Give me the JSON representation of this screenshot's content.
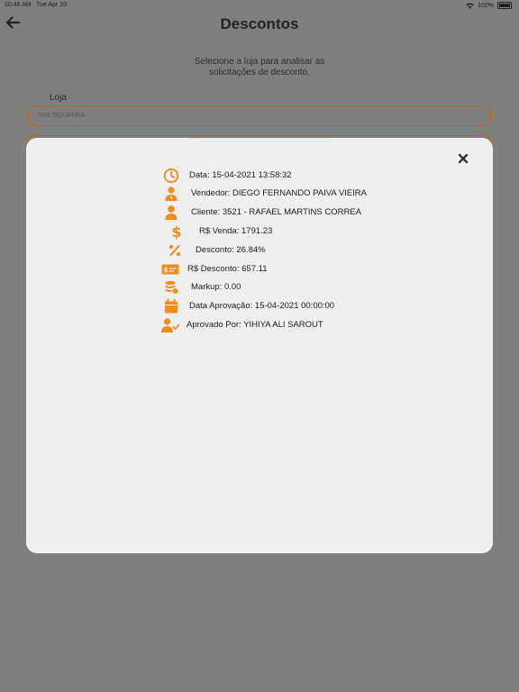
{
  "status": {
    "time": "10:46 AM",
    "date": "Tue Apr 20",
    "battery": "100%"
  },
  "header": {
    "title": "Descontos"
  },
  "page": {
    "subtitle_line1": "Selecione a loja para analisar as",
    "subtitle_line2": "solicitações de desconto.",
    "loja_label": "Loja",
    "loja_value": "YAS TIQUATIRA"
  },
  "detail": {
    "date": "Data: 15-04-2021 13:58:32",
    "seller": "Vendedor: DIEGO FERNANDO PAIVA VIEIRA",
    "client": "Cliente: 3521 - RAFAEL MARTINS CORREA",
    "sale": "R$ Venda: 1791.23",
    "discount": "Desconto: 26.84%",
    "discount_value": "R$ Desconto: 657.11",
    "markup": "Markup: 0.00",
    "approval_date": "Data Aprovação: 15-04-2021 00:00:00",
    "approved_by": "Aprovado Por: YIHIYA ALI SAROUT"
  },
  "colors": {
    "accent": "#f28c1c",
    "modal_bg": "#efefef",
    "overlay": "#7f7f7f"
  }
}
